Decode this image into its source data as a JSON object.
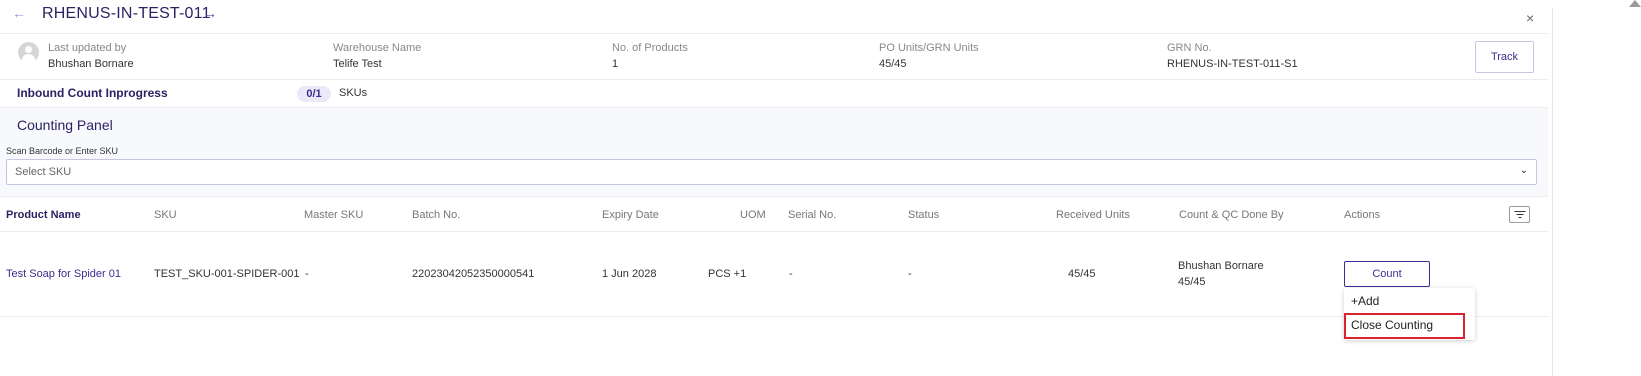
{
  "header": {
    "title": "RHENUS-IN-TEST-011",
    "back_icon": "←",
    "forward_icon": "→",
    "close_icon": "×"
  },
  "info": {
    "last_updated_label": "Last updated by",
    "last_updated_value": "Bhushan Bornare",
    "warehouse_label": "Warehouse Name",
    "warehouse_value": "Telife Test",
    "products_label": "No. of Products",
    "products_value": "1",
    "units_label": "PO Units/GRN Units",
    "units_value": "45/45",
    "grn_label": "GRN No.",
    "grn_value": "RHENUS-IN-TEST-011-S1",
    "track_label": "Track"
  },
  "progress": {
    "label": "Inbound Count Inprogress",
    "count": "0/1",
    "unit": "SKUs"
  },
  "panel": {
    "title": "Counting Panel",
    "scan_label": "Scan Barcode or Enter SKU",
    "select_placeholder": "Select SKU",
    "chevron_icon": "⌄"
  },
  "table": {
    "columns": {
      "product_name": "Product Name",
      "sku": "SKU",
      "master_sku": "Master SKU",
      "batch_no": "Batch No.",
      "expiry_date": "Expiry Date",
      "uom": "UOM",
      "serial_no": "Serial No.",
      "status": "Status",
      "received_units": "Received Units",
      "count_qc_done_by": "Count & QC Done By",
      "actions": "Actions"
    },
    "rows": [
      {
        "product_name": "Test Soap for Spider 01",
        "sku": "TEST_SKU-001-SPIDER-001",
        "master_sku": "-",
        "batch_no": "22023042052350000541",
        "expiry_date": "1 Jun 2028",
        "uom": "PCS +1",
        "serial_no": "-",
        "status": "-",
        "received_units": "45/45",
        "done_by_name": "Bhushan Bornare",
        "done_by_units": "45/45",
        "count_label": "Count"
      }
    ]
  },
  "actions_menu": {
    "add_label": "+Add",
    "close_counting_label": "Close Counting",
    "highlight_color": "#d9232e"
  },
  "colors": {
    "accent": "#3b2f8f",
    "title": "#2c2163",
    "pill_bg": "#ebe8f7",
    "panel_bg": "#f7f9fc"
  }
}
